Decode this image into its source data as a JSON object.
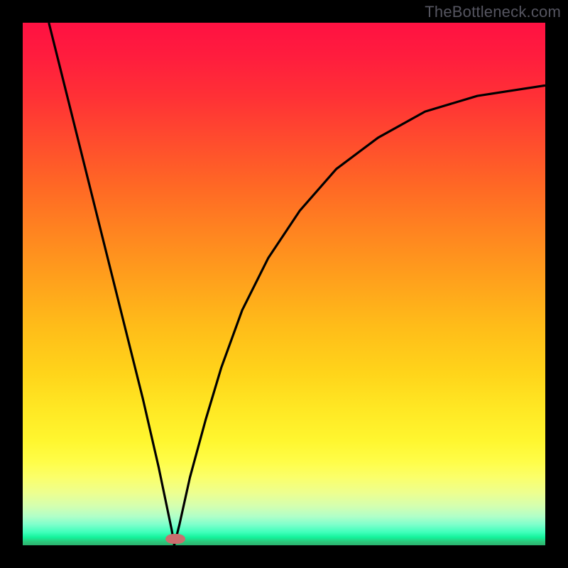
{
  "watermark": "TheBottleneck.com",
  "colors": {
    "frame": "#000000",
    "curve": "#000000",
    "marker": "#cb6e6e",
    "gradient_top": "#ff1142",
    "gradient_bottom": "#2bb36e"
  },
  "chart_data": {
    "type": "line",
    "title": "",
    "xlabel": "",
    "ylabel": "",
    "xlim": [
      0,
      100
    ],
    "ylim": [
      0,
      100
    ],
    "grid": false,
    "legend": false,
    "note": "V-shaped bottleneck curve over vertical red→green performance gradient. Minimum near x≈29, y≈0. Axis values are normalized estimates (no tick labels visible).",
    "series": [
      {
        "name": "bottleneck-curve",
        "x": [
          5,
          8,
          11,
          14,
          17,
          20,
          23,
          26,
          28.5,
          29,
          30,
          32,
          35,
          38,
          42,
          47,
          53,
          60,
          68,
          77,
          87,
          100
        ],
        "y": [
          100,
          88,
          76,
          64,
          52,
          40,
          28,
          15,
          3,
          0,
          4,
          13,
          24,
          34,
          45,
          55,
          64,
          72,
          78,
          83,
          86,
          88
        ]
      }
    ],
    "marker": {
      "x": 29,
      "y": 0,
      "shape": "pill",
      "color": "#cb6e6e"
    }
  }
}
